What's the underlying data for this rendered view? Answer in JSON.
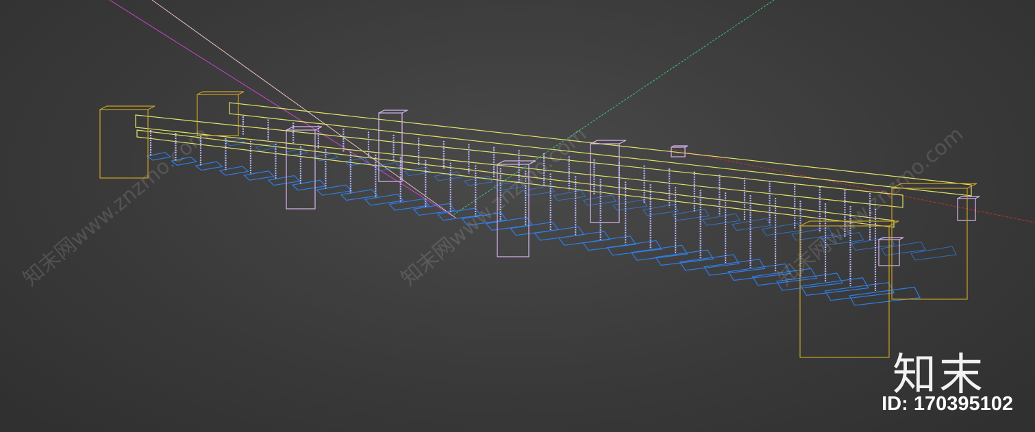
{
  "watermark": {
    "site": "知末网www.znzmo.com"
  },
  "brand": {
    "logo_text": "知末",
    "asset_id": "ID: 170395102"
  },
  "scene": {
    "background": "#3a3a3a",
    "colors": {
      "posts": "#c9a227",
      "rails": "#e3e36a",
      "planks": "#2f7de6",
      "chains": "#b8b8ff",
      "piers": "#d9b8f0",
      "axis_green": "#2fd07a",
      "axis_red": "#c03030",
      "line_magenta": "#d040d0",
      "line_pink": "#f0c0c0"
    }
  }
}
